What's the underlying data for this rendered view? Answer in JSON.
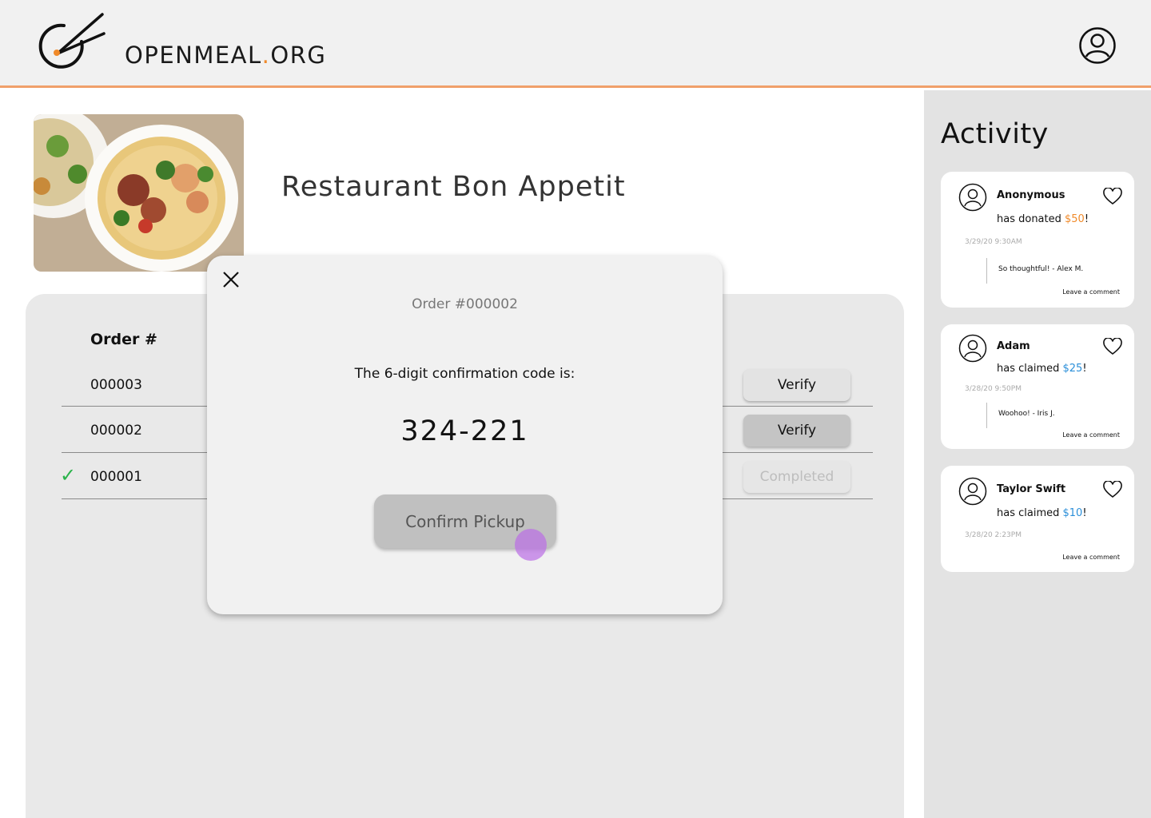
{
  "brand": {
    "name_part1": "OPENMEAL",
    "name_dot": ".",
    "name_part2": "ORG"
  },
  "restaurant": {
    "name": "Restaurant Bon Appetit"
  },
  "orders": {
    "header": "Order #",
    "rows": [
      {
        "number": "000003",
        "button": "Verify",
        "state": "pending"
      },
      {
        "number": "000002",
        "button": "Verify",
        "state": "selected"
      },
      {
        "number": "000001",
        "button": "Completed",
        "state": "completed",
        "check": "✓"
      }
    ]
  },
  "modal": {
    "order_label": "Order #000002",
    "message": "The 6-digit confirmation code is:",
    "code": "324-221",
    "confirm_label": "Confirm Pickup"
  },
  "activity": {
    "title": "Activity",
    "items": [
      {
        "user": "Anonymous",
        "action": "has donated ",
        "amount": "$50",
        "suffix": "!",
        "time": "3/29/20  9:30AM",
        "comment": "So thoughtful! - Alex M.",
        "leave": "Leave a comment",
        "amount_color": "#f08a2a"
      },
      {
        "user": "Adam",
        "action": "has claimed ",
        "amount": "$25",
        "suffix": "!",
        "time": "3/28/20  9:50PM",
        "comment": "Woohoo! - Iris J.",
        "leave": "Leave a comment",
        "amount_color": "#2b8fd9"
      },
      {
        "user": "Taylor Swift",
        "action": "has claimed ",
        "amount": "$10",
        "suffix": "!",
        "time": "3/28/20  2:23PM",
        "leave": "Leave a comment",
        "amount_color": "#2b8fd9"
      }
    ]
  },
  "colors": {
    "accent": "#f08a2a",
    "header_border": "#f0a06a",
    "check": "#29b34a"
  }
}
